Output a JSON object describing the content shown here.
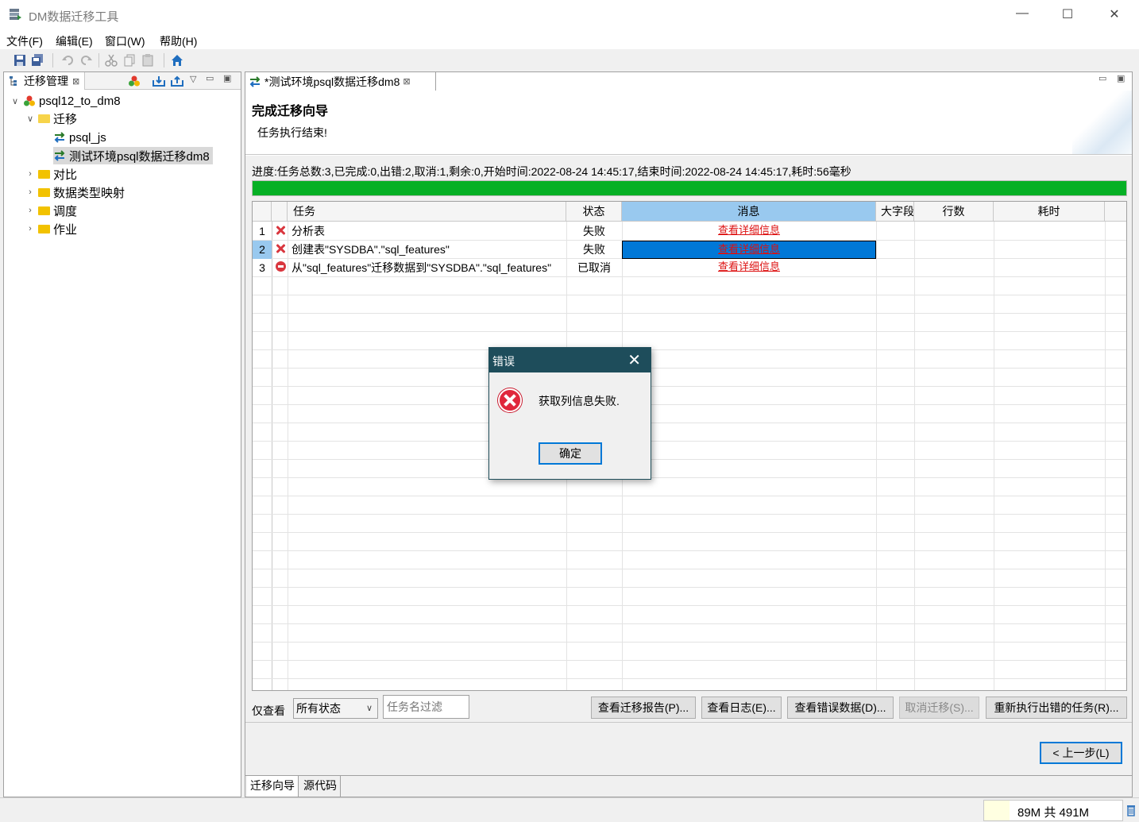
{
  "window": {
    "title": "DM数据迁移工具"
  },
  "menu": [
    "文件(F)",
    "编辑(E)",
    "窗口(W)",
    "帮助(H)"
  ],
  "left_panel": {
    "tab_label": "迁移管理",
    "tree": {
      "project": "psql12_to_dm8",
      "migration_folder": "迁移",
      "migrations": [
        "psql_js",
        "测试环境psql数据迁移dm8"
      ],
      "folders": [
        "对比",
        "数据类型映射",
        "调度",
        "作业"
      ]
    }
  },
  "editor": {
    "tab_label": "*测试环境psql数据迁移dm8",
    "wizard_title": "完成迁移向导",
    "wizard_subtitle": "任务执行结束!",
    "progress_text": "进度:任务总数:3,已完成:0,出错:2,取消:1,剩余:0,开始时间:2022-08-24 14:45:17,结束时间:2022-08-24 14:45:17,耗时:56毫秒",
    "progress_fraction": 1.0,
    "columns": [
      "任务",
      "状态",
      "消息",
      "大字段",
      "行数",
      "耗时"
    ],
    "rows": [
      {
        "num": "1",
        "icon": "error-x-icon",
        "task": "分析表",
        "status": "失败",
        "message": "查看详细信息"
      },
      {
        "num": "2",
        "icon": "error-x-icon",
        "task": "创建表\"SYSDBA\".\"sql_features\"",
        "status": "失败",
        "message": "查看详细信息"
      },
      {
        "num": "3",
        "icon": "cancelled-stop-icon",
        "task": "从\"sql_features\"迁移数据到\"SYSDBA\".\"sql_features\"",
        "status": "已取消",
        "message": "查看详细信息"
      }
    ],
    "filter": {
      "label": "仅查看",
      "status_selected": "所有状态",
      "name_placeholder": "任务名过滤"
    },
    "buttons": {
      "report": "查看迁移报告(P)...",
      "log": "查看日志(E)...",
      "error_data": "查看错误数据(D)...",
      "cancel": "取消迁移(S)...",
      "rerun": "重新执行出错的任务(R)...",
      "prev": "< 上一步(L)"
    },
    "bottom_tabs": [
      "迁移向导",
      "源代码"
    ]
  },
  "status": {
    "memory": "89M 共 491M"
  },
  "dialog": {
    "title": "错误",
    "message": "获取列信息失败.",
    "ok": "确定"
  },
  "colors": {
    "progress": "#06b025",
    "selection": "#0078d7",
    "dialog_title": "#1e4d5b",
    "error": "#d9363e"
  }
}
